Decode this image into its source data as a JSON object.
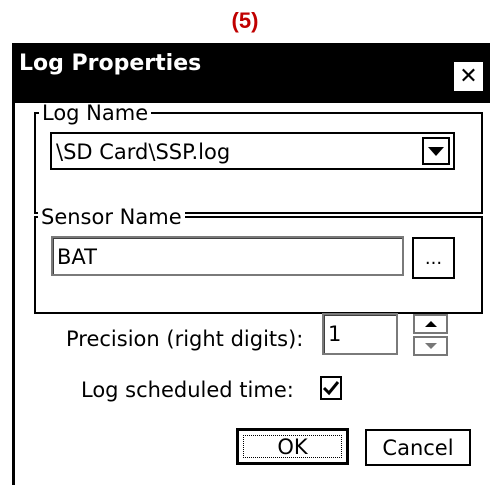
{
  "step_label": "(5)",
  "dialog": {
    "title": "Log Properties",
    "close_label": "✕"
  },
  "log_name": {
    "legend": "Log Name",
    "value": "\\SD Card\\SSP.log"
  },
  "sensor_name": {
    "legend": "Sensor Name",
    "value": "BAT",
    "browse_label": "..."
  },
  "precision": {
    "label": "Precision (right digits):",
    "value": "1"
  },
  "schedule": {
    "label": "Log scheduled time:",
    "checked": true,
    "check_glyph": "✓"
  },
  "buttons": {
    "ok_label": "OK",
    "cancel_label": "Cancel"
  },
  "colors": {
    "step_label": "#c00000",
    "titlebar": "#000000"
  }
}
